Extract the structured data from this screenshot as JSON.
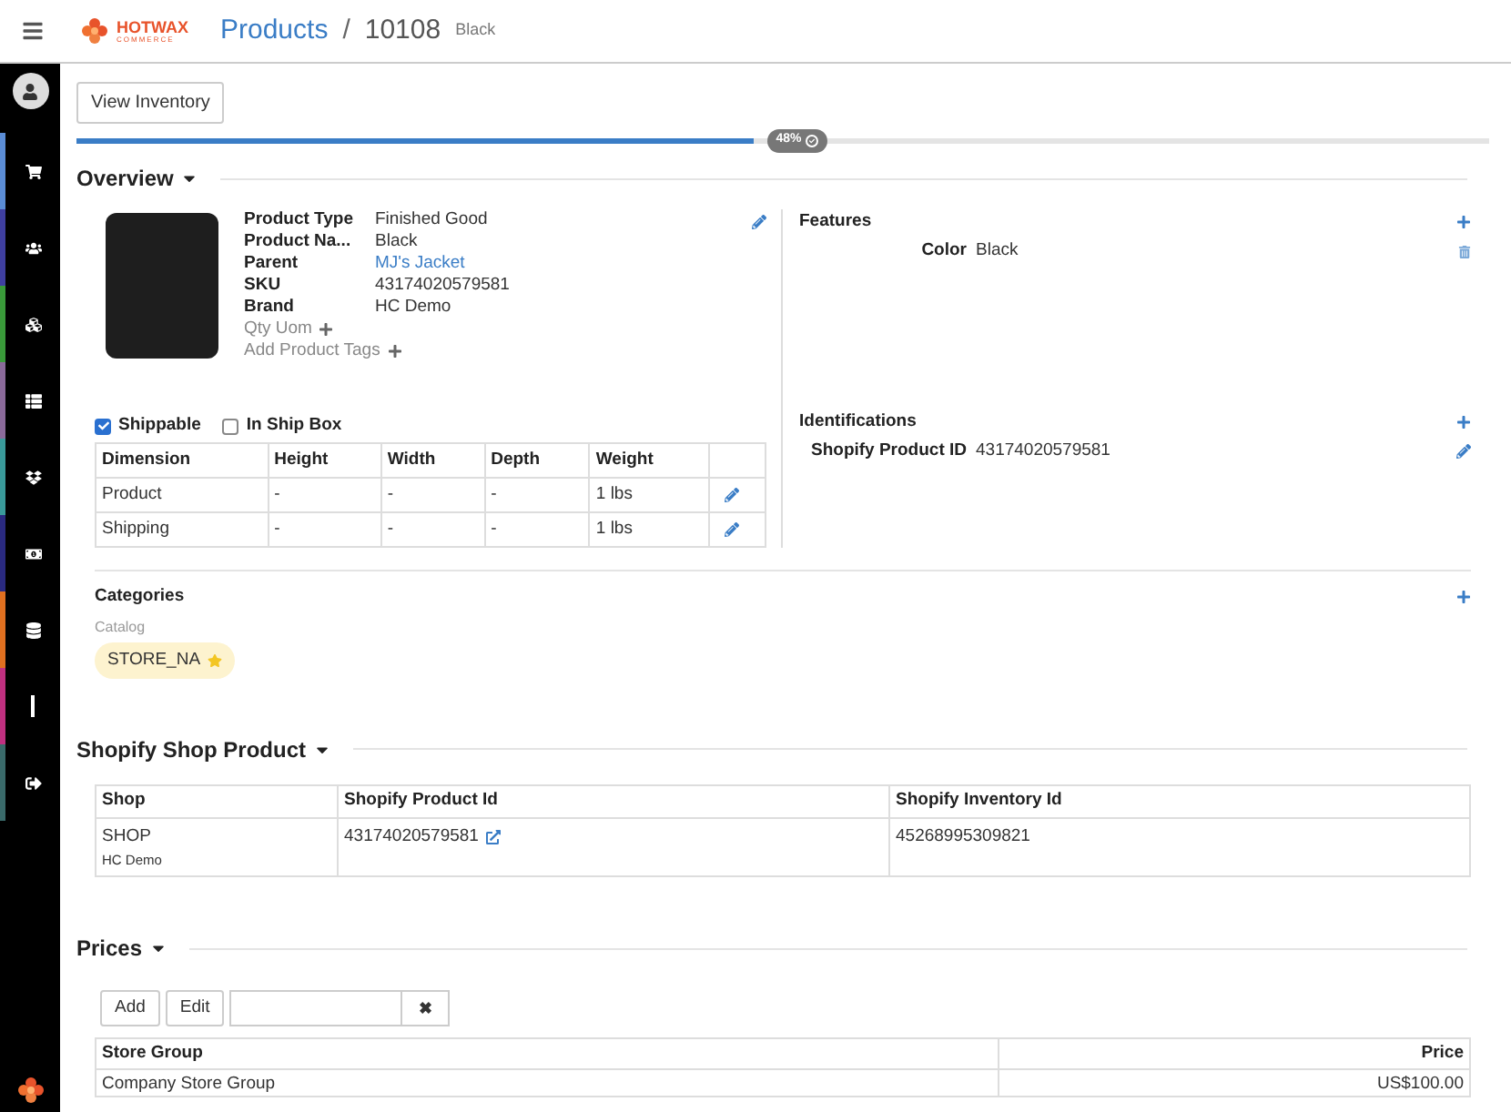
{
  "header": {
    "logo": {
      "name": "HOTWAX",
      "tagline": "COMMERCE"
    },
    "breadcrumb": [
      "Products",
      "10108"
    ],
    "separator": "/",
    "subtitle": "Black"
  },
  "sidebar": {
    "items": [
      {
        "kind": "cart",
        "color": "#5b8dd6"
      },
      {
        "kind": "users",
        "color": "#3f3fa0"
      },
      {
        "kind": "cubes",
        "color": "#3a9a3a"
      },
      {
        "kind": "list",
        "color": "#8a6a9a"
      },
      {
        "kind": "dropbox",
        "color": "#3a9a9a"
      },
      {
        "kind": "money",
        "color": "#2a2a80"
      },
      {
        "kind": "database",
        "color": "#e07020"
      },
      {
        "kind": "bar",
        "color": "#c03080"
      },
      {
        "kind": "signout",
        "color": "#3a6a6a"
      }
    ]
  },
  "toolbar": {
    "button": "View Inventory"
  },
  "progress": {
    "level": 0.48,
    "label": "48%"
  },
  "overview": {
    "title": "Overview",
    "details": [
      {
        "label": "Product Type",
        "value": "Finished Good",
        "kind": "text"
      },
      {
        "label": "Product Na...",
        "value": "Black",
        "kind": "text"
      },
      {
        "label": "Parent",
        "value": "MJ's Jacket",
        "kind": "link"
      },
      {
        "label": "SKU",
        "value": "43174020579581",
        "kind": "text"
      },
      {
        "label": "Brand",
        "value": "HC Demo",
        "kind": "text"
      }
    ],
    "actions": [
      "Qty Uom",
      "Add Product Tags"
    ],
    "checks": [
      {
        "label": "Shippable",
        "checked": true
      },
      {
        "label": "In Ship Box",
        "checked": false
      }
    ],
    "dimensions": {
      "columns": [
        "Dimension",
        "Height",
        "Width",
        "Depth",
        "Weight"
      ],
      "rows": [
        [
          "Product",
          "-",
          "-",
          "-",
          "1 lbs"
        ],
        [
          "Shipping",
          "-",
          "-",
          "-",
          "1 lbs"
        ]
      ]
    },
    "features": {
      "title": "Features",
      "items": [
        {
          "label": "Color",
          "value": "Black"
        }
      ]
    },
    "identifications": {
      "title": "Identifications",
      "items": [
        {
          "label": "Shopify Product ID",
          "value": "43174020579581"
        }
      ]
    },
    "categories": {
      "title": "Categories",
      "group": "Catalog",
      "tags": [
        {
          "label": "STORE_NA",
          "starred": true
        }
      ]
    }
  },
  "shop_product": {
    "title": "Shopify Shop Product",
    "columns": [
      "Shop",
      "Shopify Product Id",
      "Shopify Inventory Id"
    ],
    "rows": [
      {
        "shop": "SHOP",
        "store": "HC Demo",
        "product_id": "43174020579581",
        "inventory_id": "45268995309821"
      }
    ]
  },
  "prices": {
    "title": "Prices",
    "buttons": [
      "Add",
      "Edit"
    ],
    "clear": "✖",
    "columns": [
      "Store Group",
      "Price"
    ],
    "rows": [
      [
        "Company Store Group",
        "US$100.00"
      ]
    ]
  }
}
